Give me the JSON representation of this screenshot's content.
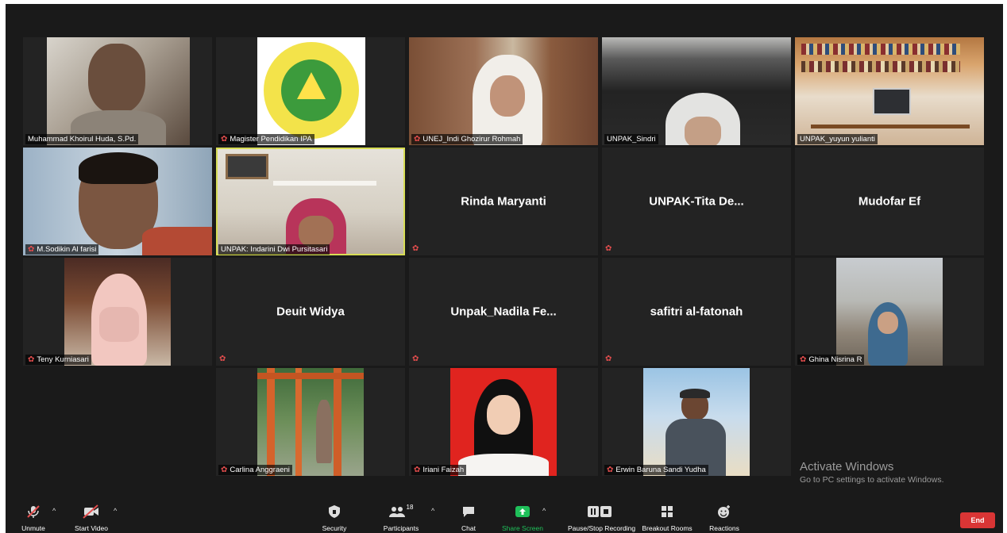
{
  "participants": [
    {
      "name": "Muhammad Khoirul Huda, S.Pd."
    },
    {
      "name": "Magister Pendidikan IPA"
    },
    {
      "name": "UNEJ_Indi Ghozirur Rohmah"
    },
    {
      "name": "UNPAK_Sindri"
    },
    {
      "name": "UNPAK_yuyun yulianti"
    },
    {
      "name": "M.Sodikin Al farisi"
    },
    {
      "name": "UNPAK: Indarini Dwi Pursitasari"
    },
    {
      "name": "Rinda Maryanti"
    },
    {
      "name": "UNPAK-Tita  De..."
    },
    {
      "name": "Mudofar Ef"
    },
    {
      "name": "Teny Kurniasari"
    },
    {
      "name": "Deuit Widya"
    },
    {
      "name": "Unpak_Nadila  Fe..."
    },
    {
      "name": "safitri al-fatonah"
    },
    {
      "name": "Ghina Nisrina R"
    },
    {
      "name": "Carlina Anggraeni"
    },
    {
      "name": "Iriani Faizah"
    },
    {
      "name": "Erwin Baruna Sandi Yudha"
    }
  ],
  "watermark": {
    "title": "Activate Windows",
    "subtitle": "Go to PC settings to activate Windows."
  },
  "toolbar": {
    "unmute": "Unmute",
    "start_video": "Start Video",
    "security": "Security",
    "participants": "Participants",
    "participants_count": "18",
    "chat": "Chat",
    "share_screen": "Share Screen",
    "pause_recording": "Pause/Stop Recording",
    "breakout_rooms": "Breakout Rooms",
    "reactions": "Reactions",
    "end": "End"
  },
  "colors": {
    "active_speaker": "#d7dd55",
    "share_green": "#1fc05a",
    "end_red": "#d93535",
    "muted_red": "#e24d4d"
  }
}
